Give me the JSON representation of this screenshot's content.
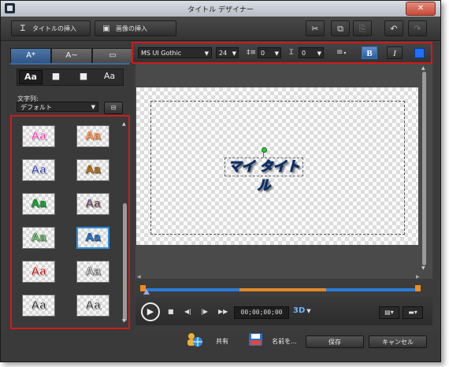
{
  "window": {
    "title": "タイトル デザイナー"
  },
  "toolbar": {
    "insert_title": {
      "icon": "T-text-icon",
      "label": "タイトルの挿入"
    },
    "insert_image": {
      "icon": "image-icon",
      "label": "画像の挿入"
    },
    "right_icons": [
      "scissors-icon",
      "copy-icon",
      "paste-icon",
      "undo-icon",
      "redo-icon"
    ]
  },
  "left_panel": {
    "tabs": [
      {
        "label": "A*",
        "icon": "text-effects-icon",
        "active": true
      },
      {
        "label": "A~",
        "icon": "text-motion-icon",
        "active": false
      },
      {
        "label": "▭",
        "icon": "background-icon",
        "active": false
      }
    ],
    "style_buttons": [
      {
        "label": "Aa",
        "icon": "plain-text-icon",
        "selected": true
      },
      {
        "label": "■",
        "icon": "shadow-box-icon",
        "selected": false
      },
      {
        "label": "■",
        "icon": "drop-shadow-icon",
        "selected": false
      },
      {
        "label": "Aa",
        "icon": "outline-text-icon",
        "selected": false
      }
    ],
    "style_label": "文字列:",
    "style_dropdown": "デフォルト",
    "style_dropdown_btn": "⊟",
    "presets": [
      {
        "text": "Aa",
        "color": "#ff2bb0",
        "stroke": "#ffffff",
        "selected": false
      },
      {
        "text": "Aa",
        "color": "#ffb079",
        "stroke": "#c85a20",
        "selected": false
      },
      {
        "text": "Aa",
        "color": "#1c2fa6",
        "stroke": "#ffffff",
        "selected": false
      },
      {
        "text": "Aa",
        "color": "#c78222",
        "stroke": "#6b3c05",
        "selected": false
      },
      {
        "text": "Aa",
        "color": "#19b83a",
        "stroke": "#0a5a1a",
        "selected": false
      },
      {
        "text": "Aa",
        "color": "#4b2fa5",
        "stroke": "#c8b25a",
        "selected": false
      },
      {
        "text": "Aa",
        "color": "#8fd08f",
        "stroke": "#2e6e2e",
        "selected": false
      },
      {
        "text": "Aa",
        "color": "#2f8fe0",
        "stroke": "#0b2f66",
        "selected": true
      },
      {
        "text": "Aa",
        "color": "#c00000",
        "stroke": "#ffffff",
        "selected": false
      },
      {
        "text": "Aa",
        "color": "#e8e8e8",
        "stroke": "#555555",
        "selected": false
      },
      {
        "text": "Aa",
        "color": "#222222",
        "stroke": "#ffffff",
        "selected": false
      },
      {
        "text": "Aa",
        "color": "#2a2a2a",
        "stroke": "#ffffff",
        "selected": false
      }
    ]
  },
  "format_bar": {
    "font": "MS UI Gothic",
    "size": "24",
    "line_spacing_icon": "line-spacing-icon",
    "line_spacing": "0",
    "char_spacing_icon": "char-spacing-icon",
    "char_spacing": "0",
    "align_icon": "align-icon",
    "bold": "B",
    "italic": "I",
    "color": "#1e6fff"
  },
  "preview": {
    "title_text": "マイ タイトル",
    "title_color": "#3a8ee8"
  },
  "transport": {
    "timecode": "00;00;00;00",
    "three_d": "3D",
    "icons": [
      "play-icon",
      "stop-icon",
      "previous-frame-icon",
      "next-frame-icon",
      "fast-forward-icon"
    ]
  },
  "footer": {
    "share": "共有",
    "save_as": "名前を...",
    "save": "保存",
    "cancel": "キャンセル"
  },
  "colors": {
    "highlight": "#d11b1b",
    "accent": "#2f5585"
  }
}
